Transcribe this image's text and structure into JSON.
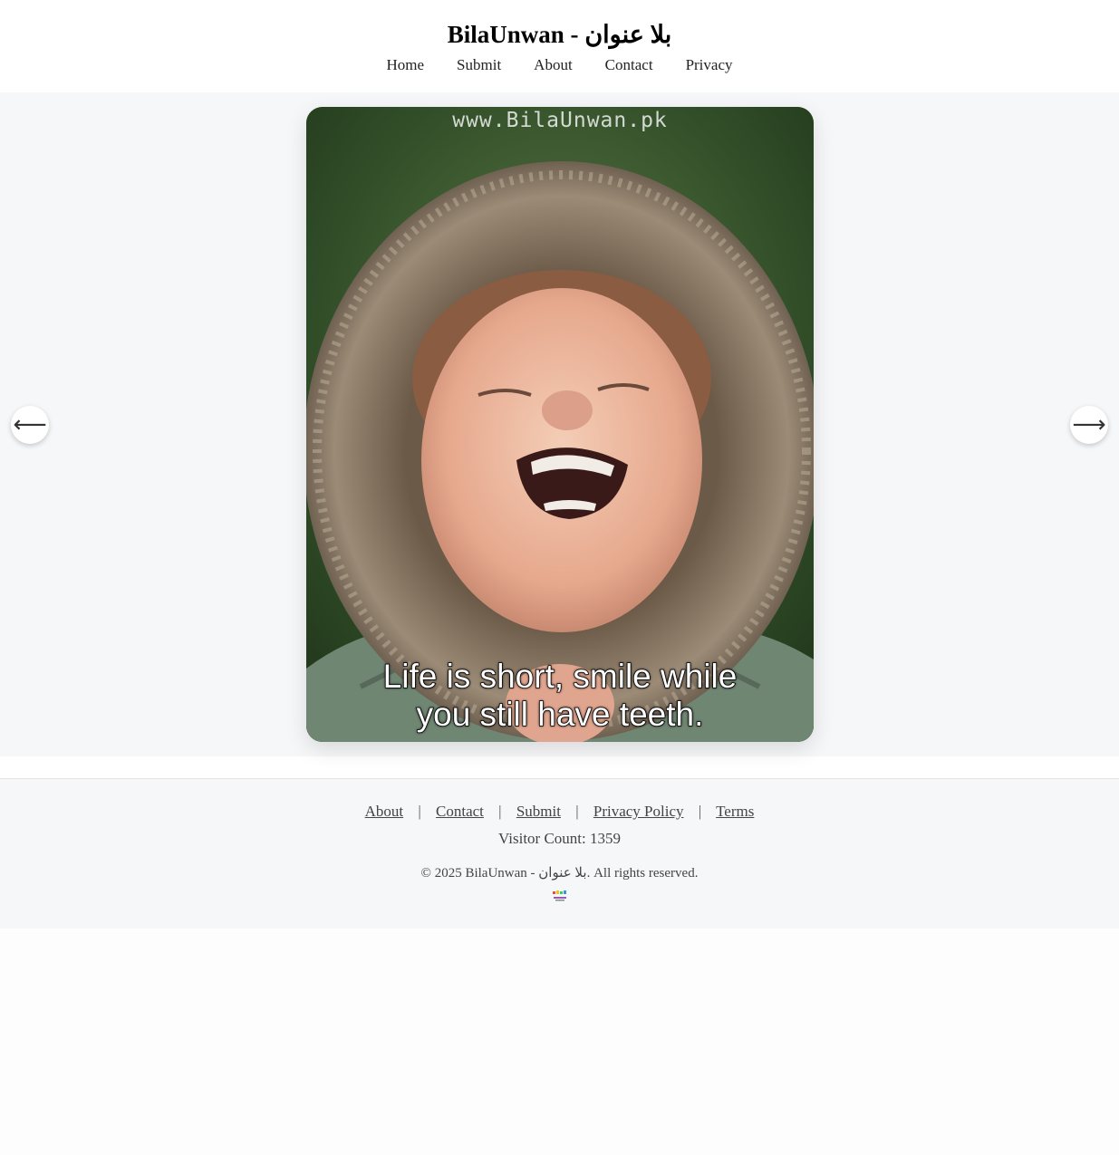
{
  "site": {
    "title": "BilaUnwan - بلا عنوان"
  },
  "nav": {
    "items": [
      "Home",
      "Submit",
      "About",
      "Contact",
      "Privacy"
    ]
  },
  "slide": {
    "watermark": "www.BilaUnwan.pk",
    "caption_line1": "Life is short, smile while",
    "caption_line2": "you still have teeth."
  },
  "controls": {
    "prev_icon": "arrow-left-icon",
    "next_icon": "arrow-right-icon",
    "prev_glyph": "⟵",
    "next_glyph": "⟶"
  },
  "footer": {
    "links": [
      "About",
      "Contact",
      "Submit",
      "Privacy Policy",
      "Terms"
    ],
    "separator": "|",
    "visitor_count": "Visitor Count: 1359",
    "copyright": "© 2025 BilaUnwan - بلا عنوان. All rights reserved.",
    "badge_icon": "site-logo-badge-icon"
  }
}
